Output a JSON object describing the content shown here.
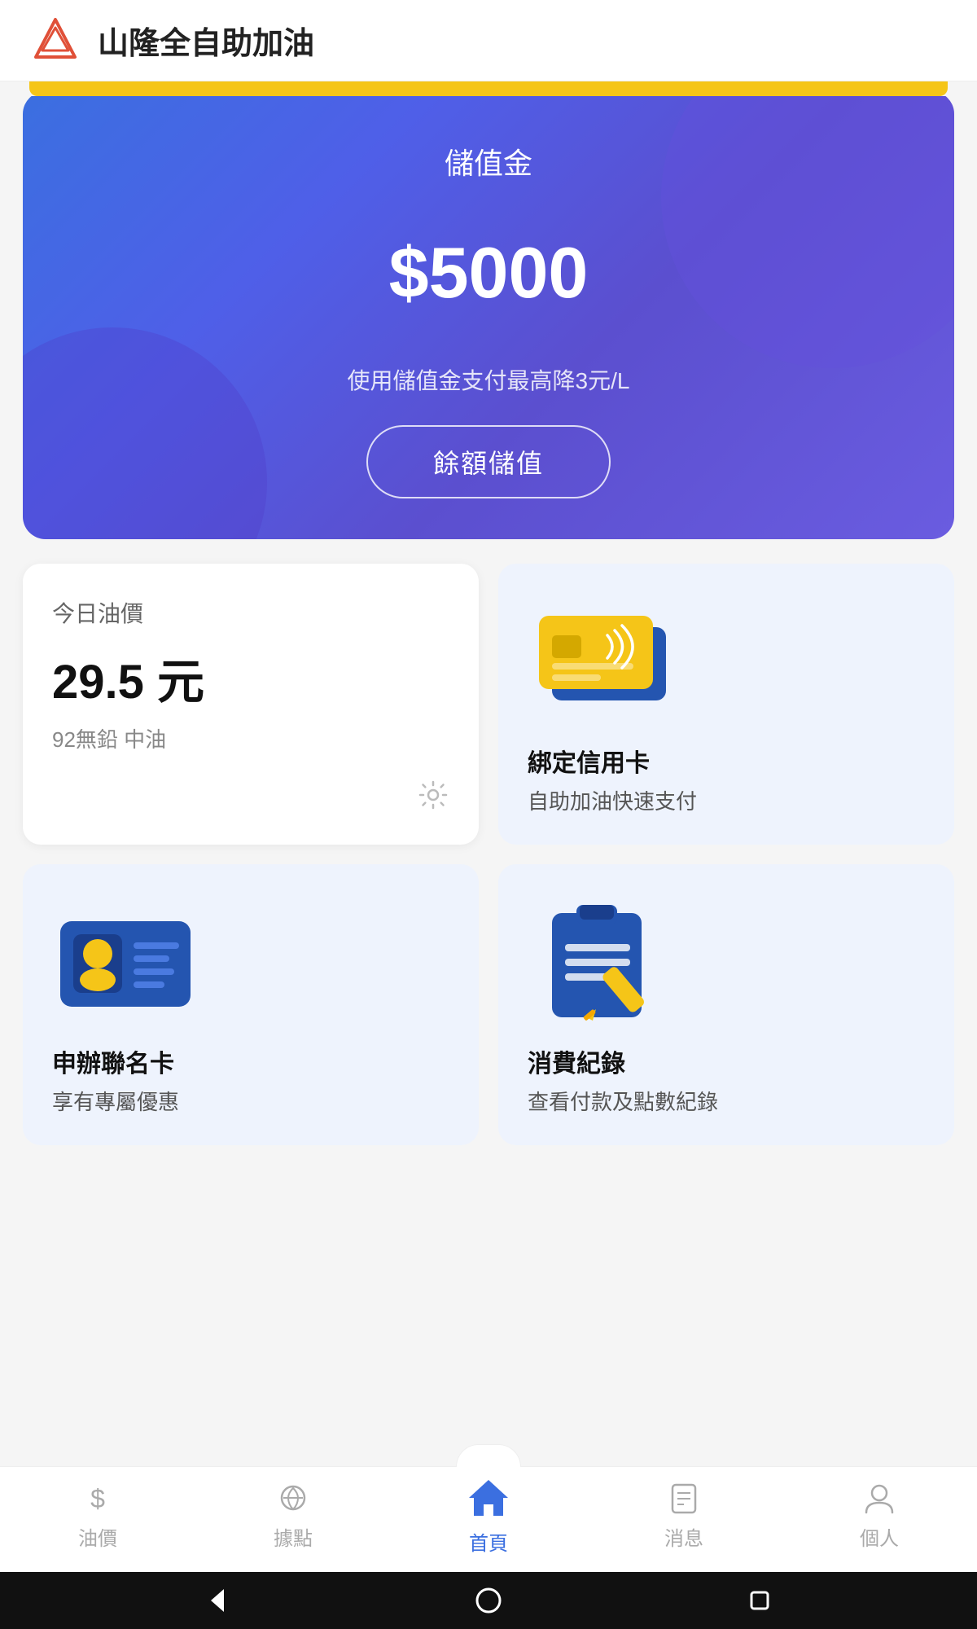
{
  "header": {
    "logo_alt": "山隆 logo",
    "title": "山隆全自助加油"
  },
  "balance_card": {
    "label": "儲值金",
    "amount": "$5000",
    "hint": "使用儲值金支付最高降3元/L",
    "button_label": "餘額儲值"
  },
  "oil_price": {
    "date_label": "今日油價",
    "price": "29.5 元",
    "type": "92無鉛 中油"
  },
  "features": [
    {
      "id": "credit-card",
      "title": "綁定信用卡",
      "subtitle": "自助加油快速支付"
    },
    {
      "id": "member-card",
      "title": "申辦聯名卡",
      "subtitle": "享有專屬優惠"
    },
    {
      "id": "consumption",
      "title": "消費紀錄",
      "subtitle": "查看付款及點數紀錄"
    }
  ],
  "bottom_nav": {
    "items": [
      {
        "id": "oil",
        "label": "油價",
        "icon": "$",
        "active": false
      },
      {
        "id": "station",
        "label": "據點",
        "icon": "⛽",
        "active": false
      },
      {
        "id": "home",
        "label": "首頁",
        "icon": "🏠",
        "active": true
      },
      {
        "id": "news",
        "label": "消息",
        "icon": "📋",
        "active": false
      },
      {
        "id": "profile",
        "label": "個人",
        "icon": "👤",
        "active": false
      }
    ]
  },
  "android_nav": {
    "back": "◀",
    "home": "●",
    "recent": "■"
  }
}
